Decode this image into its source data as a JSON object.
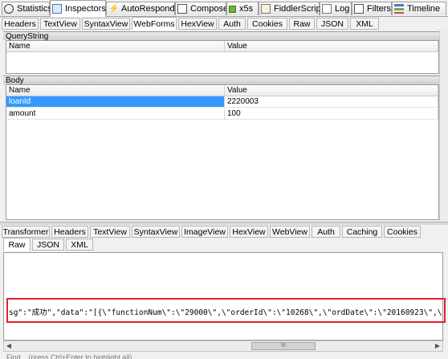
{
  "top_tabs": [
    {
      "label": "Statistics",
      "icon": "stopwatch-icon"
    },
    {
      "label": "Inspectors",
      "icon": "inspect-icon"
    },
    {
      "label": "AutoResponder",
      "icon": "lightning-icon"
    },
    {
      "label": "Composer",
      "icon": "pencil-icon"
    },
    {
      "label": "x5s",
      "icon": "x5s-icon"
    },
    {
      "label": "FiddlerScript",
      "icon": "script-icon"
    },
    {
      "label": "Log",
      "icon": "log-icon"
    },
    {
      "label": "Filters",
      "icon": "checkbox-icon"
    },
    {
      "label": "Timeline",
      "icon": "timeline-icon"
    }
  ],
  "request_tabs": [
    "Headers",
    "TextView",
    "SyntaxView",
    "WebForms",
    "HexView",
    "Auth",
    "Cookies",
    "Raw",
    "JSON",
    "XML"
  ],
  "querystring": {
    "title": "QueryString",
    "columns": [
      "Name",
      "Value"
    ],
    "rows": []
  },
  "body": {
    "title": "Body",
    "columns": [
      "Name",
      "Value"
    ],
    "rows": [
      {
        "name": "loanId",
        "value": "2220003"
      },
      {
        "name": "amount",
        "value": "100"
      }
    ]
  },
  "response_tabs_row1": [
    "Transformer",
    "Headers",
    "TextView",
    "SyntaxView",
    "ImageView",
    "HexView",
    "WebView",
    "Auth",
    "Caching",
    "Cookies"
  ],
  "response_tabs_row2": [
    "Raw",
    "JSON",
    "XML"
  ],
  "response_text": "sg\":\"成功\",\"data\":\"[{\\\"functionNum\\\":\\\"29000\\\",\\\"orderId\\\":\\\"10268\\\",\\\"ordDate\\\":\\\"20160923\\\",\\\"investorId\\\":\\\"UB",
  "scroll_grip": "III",
  "status_text": "Find... (press Ctrl+Enter to highlight all)",
  "colors": {
    "selection": "#3399ff",
    "highlight_border": "#e3202a"
  }
}
